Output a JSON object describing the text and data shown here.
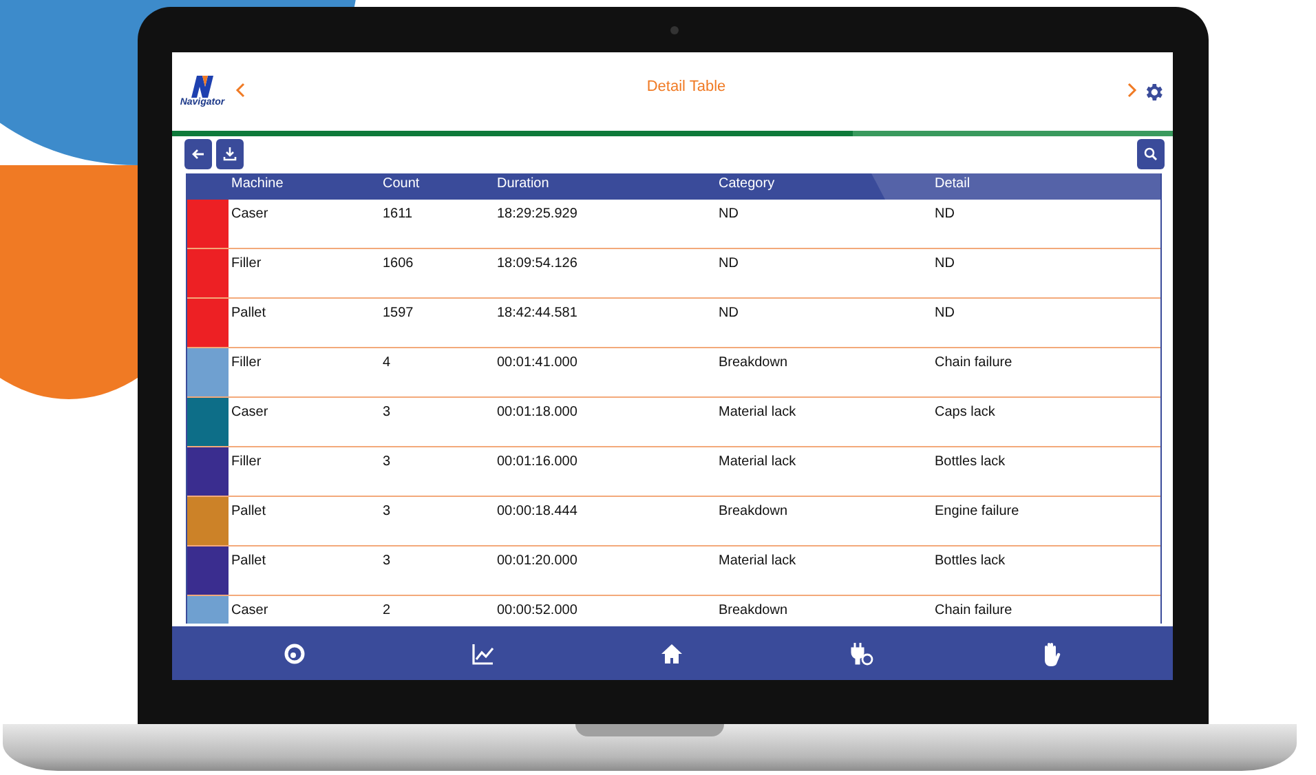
{
  "header": {
    "title": "Detail Table",
    "logo_text": "Navigator"
  },
  "table": {
    "columns": [
      "Machine",
      "Count",
      "Duration",
      "Category",
      "Detail"
    ],
    "rows": [
      {
        "color": "#ed2024",
        "machine": "Caser",
        "count": "1611",
        "duration": "18:29:25.929",
        "category": "ND",
        "detail": "ND"
      },
      {
        "color": "#ed2024",
        "machine": "Filler",
        "count": "1606",
        "duration": "18:09:54.126",
        "category": "ND",
        "detail": "ND"
      },
      {
        "color": "#ed2024",
        "machine": "Pallet",
        "count": "1597",
        "duration": "18:42:44.581",
        "category": "ND",
        "detail": "ND"
      },
      {
        "color": "#6fa0d0",
        "machine": "Filler",
        "count": "4",
        "duration": "00:01:41.000",
        "category": "Breakdown",
        "detail": "Chain failure"
      },
      {
        "color": "#0d6e88",
        "machine": "Caser",
        "count": "3",
        "duration": "00:01:18.000",
        "category": "Material lack",
        "detail": "Caps lack"
      },
      {
        "color": "#3a2d8f",
        "machine": "Filler",
        "count": "3",
        "duration": "00:01:16.000",
        "category": "Material lack",
        "detail": "Bottles lack"
      },
      {
        "color": "#cc8228",
        "machine": "Pallet",
        "count": "3",
        "duration": "00:00:18.444",
        "category": "Breakdown",
        "detail": "Engine failure"
      },
      {
        "color": "#3a2d8f",
        "machine": "Pallet",
        "count": "3",
        "duration": "00:01:20.000",
        "category": "Material lack",
        "detail": "Bottles lack"
      },
      {
        "color": "#6fa0d0",
        "machine": "Caser",
        "count": "2",
        "duration": "00:00:52.000",
        "category": "Breakdown",
        "detail": "Chain failure"
      }
    ]
  }
}
